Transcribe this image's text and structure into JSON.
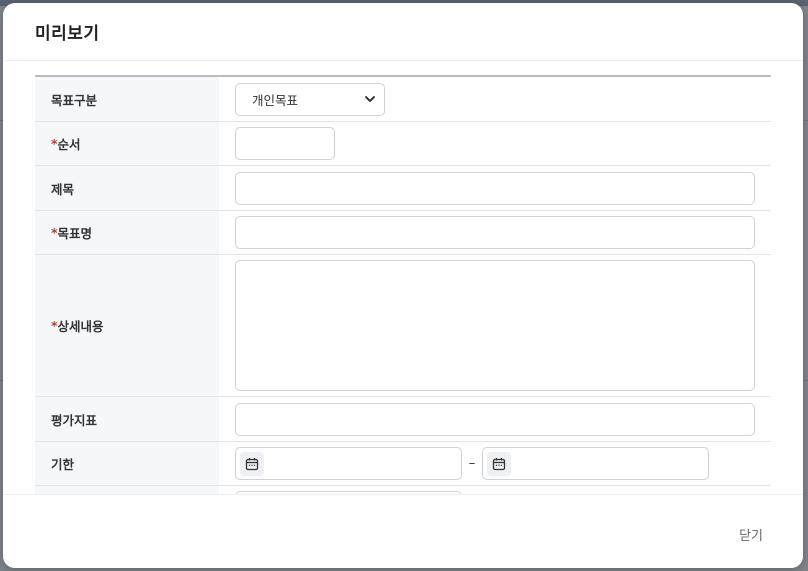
{
  "modal": {
    "title": "미리보기",
    "close_label": "닫기"
  },
  "form": {
    "goal_type": {
      "label": "목표구분",
      "selected": "개인목표"
    },
    "order": {
      "required_mark": "*",
      "label": "순서",
      "value": ""
    },
    "subject": {
      "label": "제목",
      "value": ""
    },
    "goal_name": {
      "required_mark": "*",
      "label": "목표명",
      "value": ""
    },
    "details": {
      "required_mark": "*",
      "label": "상세내용",
      "value": ""
    },
    "indicator": {
      "label": "평가지표",
      "value": ""
    },
    "deadline": {
      "label": "기한",
      "separator": "–",
      "start": "",
      "end": ""
    }
  },
  "icons": {
    "calendar": "calendar-icon",
    "dropdown": "chevron-down-icon"
  },
  "colors": {
    "required": "#c0392b",
    "label_bg": "#f6f7f9",
    "border": "#cfd3d9"
  }
}
